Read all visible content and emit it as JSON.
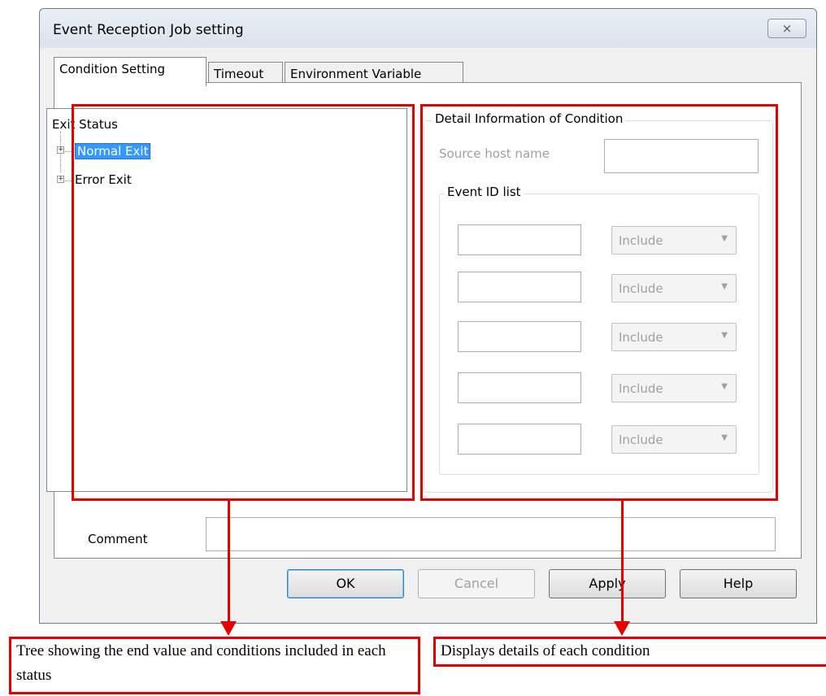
{
  "dialog": {
    "title": "Event Reception Job setting",
    "close_label": "⨯"
  },
  "tabs": [
    {
      "label": "Condition Setting",
      "active": true
    },
    {
      "label": "Timeout",
      "active": false
    },
    {
      "label": "Environment Variable",
      "active": false
    }
  ],
  "tree": {
    "root": "Exit Status",
    "items": [
      {
        "label": "Normal Exit",
        "selected": true,
        "expander": "+"
      },
      {
        "label": "Error Exit",
        "selected": false,
        "expander": "+"
      }
    ]
  },
  "detail": {
    "group_label": "Detail Information of Condition",
    "source_host_label": "Source host name",
    "source_host_value": "",
    "event_id_group_label": "Event ID list",
    "event_ids": [
      {
        "value": "",
        "mode": "Include"
      },
      {
        "value": "",
        "mode": "Include"
      },
      {
        "value": "",
        "mode": "Include"
      },
      {
        "value": "",
        "mode": "Include"
      },
      {
        "value": "",
        "mode": "Include"
      }
    ],
    "dropdown_arrow": "▼"
  },
  "comment": {
    "label": "Comment",
    "value": ""
  },
  "buttons": {
    "ok": "OK",
    "cancel": "Cancel",
    "apply": "Apply",
    "help": "Help"
  },
  "callouts": {
    "tree": "Tree showing the end value and conditions included in each status",
    "detail": "Displays details of each condition"
  },
  "colors": {
    "annotation_red": "#e60000",
    "selection_blue": "#3399ff"
  }
}
